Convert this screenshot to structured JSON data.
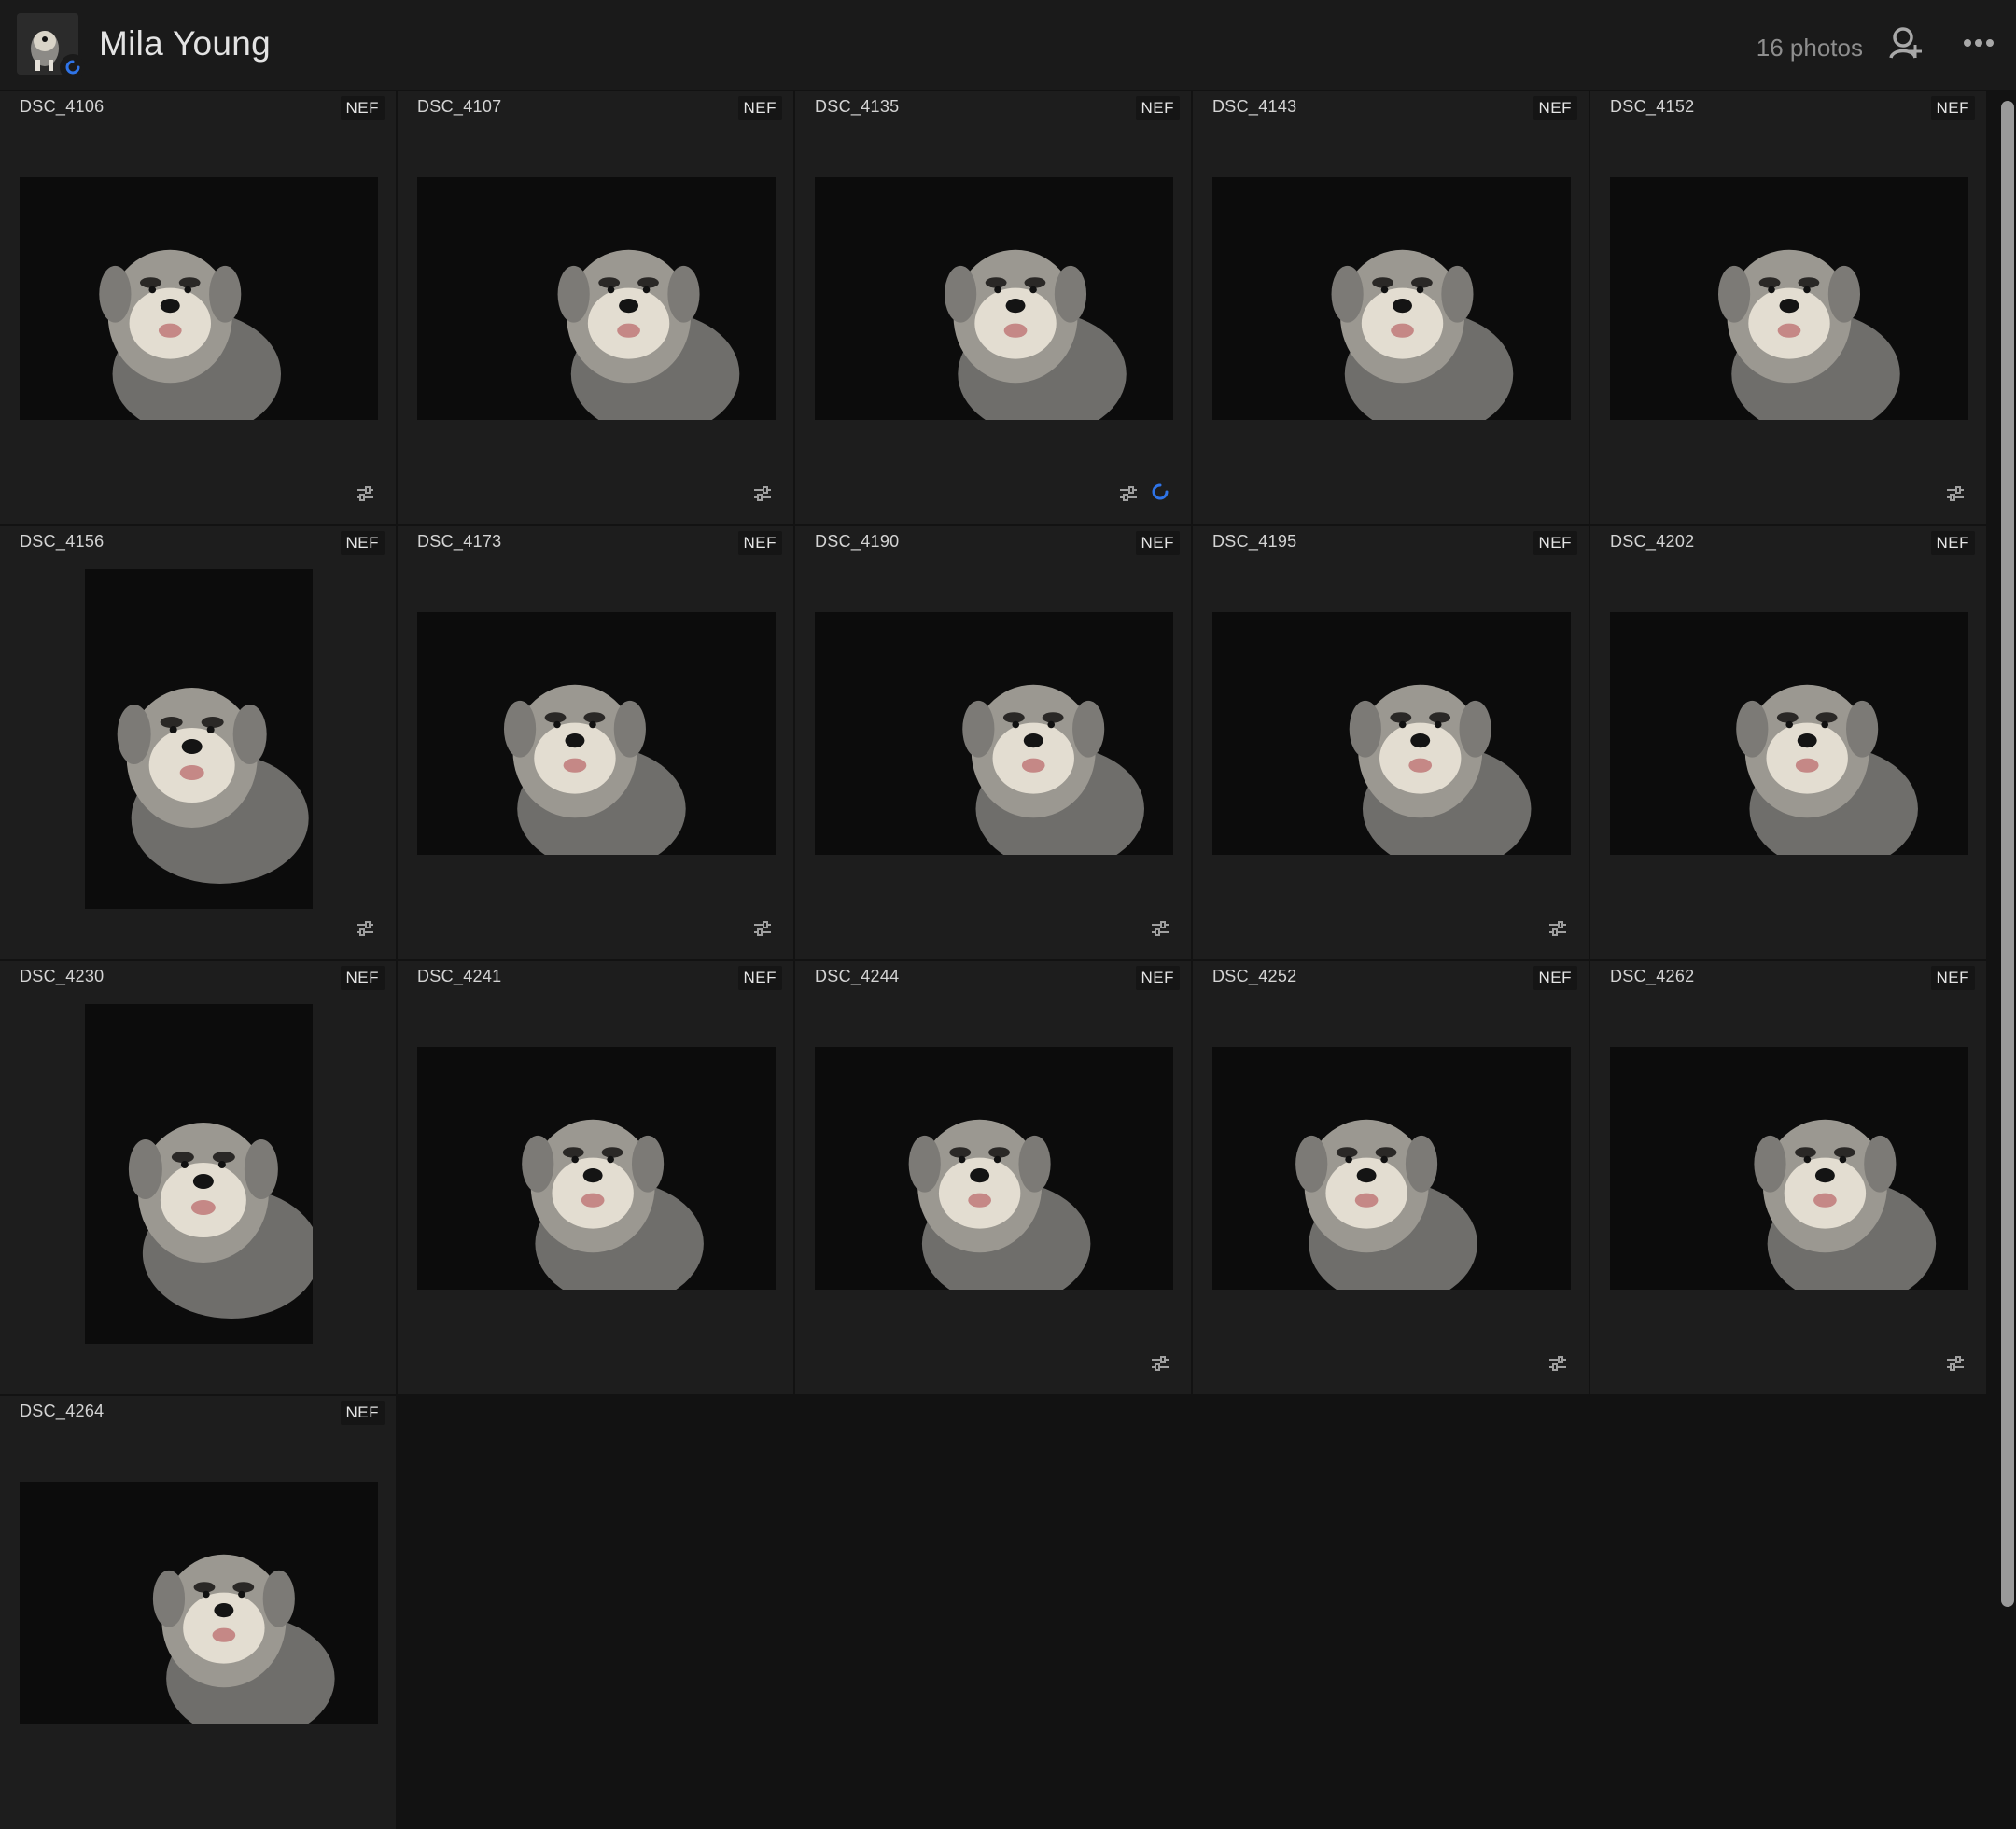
{
  "header": {
    "title": "Mila Young",
    "count": "16 photos",
    "avatar_icon": "dog-avatar",
    "sync_icon": "sync-status-icon",
    "add_person_icon": "add-person-icon",
    "more_icon": "more-icon"
  },
  "colors": {
    "accent": "#2f74e8",
    "background": "#121212",
    "cell": "#1d1d1d"
  },
  "photos": [
    {
      "name": "DSC_4106",
      "type": "NEF",
      "orientation": "landscape",
      "edited": true,
      "syncing": false
    },
    {
      "name": "DSC_4107",
      "type": "NEF",
      "orientation": "landscape",
      "edited": true,
      "syncing": false
    },
    {
      "name": "DSC_4135",
      "type": "NEF",
      "orientation": "landscape",
      "edited": true,
      "syncing": true
    },
    {
      "name": "DSC_4143",
      "type": "NEF",
      "orientation": "landscape",
      "edited": false,
      "syncing": false
    },
    {
      "name": "DSC_4152",
      "type": "NEF",
      "orientation": "landscape",
      "edited": true,
      "syncing": false
    },
    {
      "name": "DSC_4156",
      "type": "NEF",
      "orientation": "portrait",
      "edited": true,
      "syncing": false
    },
    {
      "name": "DSC_4173",
      "type": "NEF",
      "orientation": "landscape",
      "edited": true,
      "syncing": false
    },
    {
      "name": "DSC_4190",
      "type": "NEF",
      "orientation": "landscape",
      "edited": true,
      "syncing": false
    },
    {
      "name": "DSC_4195",
      "type": "NEF",
      "orientation": "landscape",
      "edited": true,
      "syncing": false
    },
    {
      "name": "DSC_4202",
      "type": "NEF",
      "orientation": "landscape",
      "edited": false,
      "syncing": false
    },
    {
      "name": "DSC_4230",
      "type": "NEF",
      "orientation": "portrait",
      "edited": false,
      "syncing": false
    },
    {
      "name": "DSC_4241",
      "type": "NEF",
      "orientation": "landscape",
      "edited": false,
      "syncing": false
    },
    {
      "name": "DSC_4244",
      "type": "NEF",
      "orientation": "landscape",
      "edited": true,
      "syncing": false
    },
    {
      "name": "DSC_4252",
      "type": "NEF",
      "orientation": "landscape",
      "edited": true,
      "syncing": false
    },
    {
      "name": "DSC_4262",
      "type": "NEF",
      "orientation": "landscape",
      "edited": true,
      "syncing": false
    },
    {
      "name": "DSC_4264",
      "type": "NEF",
      "orientation": "landscape",
      "edited": false,
      "syncing": false
    }
  ]
}
